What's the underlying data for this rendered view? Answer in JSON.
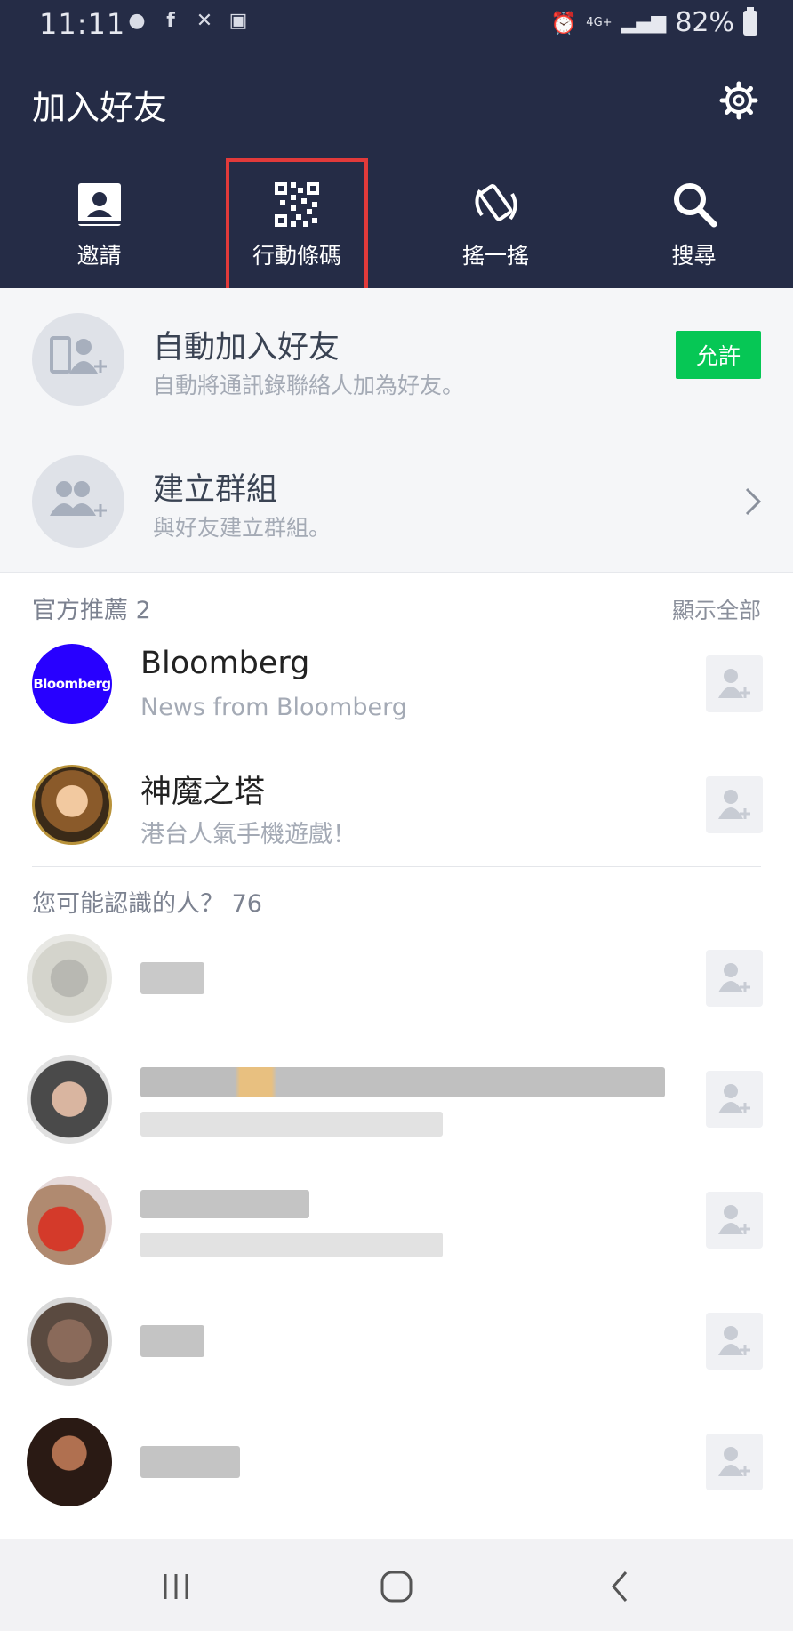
{
  "status_bar": {
    "time": "11:11",
    "battery": "82%",
    "network": "4G+",
    "notification_icons": [
      "line-icon",
      "facebook-icon",
      "missed-call-icon",
      "image-icon"
    ]
  },
  "header": {
    "title": "加入好友",
    "actions": [
      {
        "label": "邀請",
        "icon": "contact-card-icon"
      },
      {
        "label": "行動條碼",
        "icon": "qr-code-icon",
        "highlighted": true
      },
      {
        "label": "搖一搖",
        "icon": "shake-phone-icon"
      },
      {
        "label": "搜尋",
        "icon": "search-icon"
      }
    ]
  },
  "auto_add": {
    "title": "自動加入好友",
    "subtitle": "自動將通訊錄聯絡人加為好友。",
    "button_label": "允許"
  },
  "create_group": {
    "title": "建立群組",
    "subtitle": "與好友建立群組。"
  },
  "official": {
    "label": "官方推薦 2",
    "show_all": "顯示全部",
    "items": [
      {
        "name": "Bloomberg",
        "subtitle": "News from Bloomberg",
        "logo_text": "Bloomberg"
      },
      {
        "name": "神魔之塔",
        "subtitle": "港台人氣手機遊戲！"
      }
    ]
  },
  "people": {
    "label": "您可能認識的人？ 76"
  },
  "colors": {
    "header_bg": "#252c46",
    "accent_green": "#06c755",
    "highlight_red": "#e23a3a",
    "bloomberg_blue": "#2800ff"
  }
}
